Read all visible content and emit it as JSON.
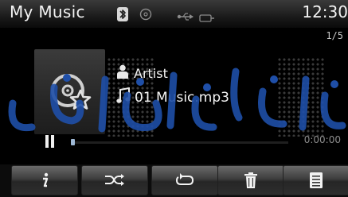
{
  "status_bar": {
    "title": "My Music",
    "time": "12:30"
  },
  "player": {
    "track_position": "1/5",
    "artist_label": "Artist",
    "file_name": "01 Music.mp3",
    "elapsed_time": "0:00:00",
    "progress": 0.0,
    "state": "paused"
  },
  "toolbar": {
    "buttons": [
      {
        "icon": "info-icon"
      },
      {
        "icon": "shuffle-icon"
      },
      {
        "icon": "repeat-icon"
      },
      {
        "icon": "trash-icon"
      },
      {
        "icon": "list-icon"
      }
    ]
  },
  "colors": {
    "watermark": "#1f4fa8",
    "progress_marker": "#9fb9d6"
  }
}
